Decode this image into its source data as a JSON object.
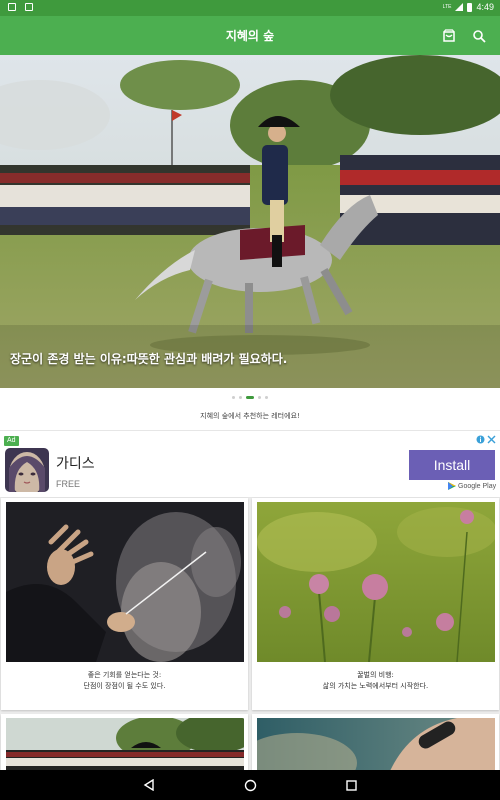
{
  "status_bar": {
    "time": "4:49",
    "network": "LTE",
    "left_icons": [
      "notification-square-icon",
      "notification-a-icon"
    ]
  },
  "app_bar": {
    "title": "지혜의 숲",
    "icons": [
      "shop-bag-icon",
      "search-icon"
    ],
    "color": "#4caf50"
  },
  "hero": {
    "caption": "장군이 존경 받는 이유:따뜻한 관심과 배려가 필요하다.",
    "page_count": 5,
    "active_page": 3
  },
  "recommend_text": "지혜의 숲에서 추천하는 레터에요!",
  "ad": {
    "badge": "Ad",
    "app_name": "가디스",
    "price": "FREE",
    "install_label": "Install",
    "store_label": "Google Play",
    "install_color": "#6b5fb5"
  },
  "cards": [
    {
      "line1": "좋은 기회를 얻는다는 것:",
      "line2": "단점이 장점이 될 수도 있다."
    },
    {
      "line1": "꿀벌의 비행:",
      "line2": "삶의 가치는 노력에서부터 시작한다."
    },
    {
      "line1": "",
      "line2": ""
    },
    {
      "line1": "",
      "line2": ""
    }
  ],
  "nav_bar": {
    "buttons": [
      "back-icon",
      "home-icon",
      "recents-icon"
    ]
  }
}
